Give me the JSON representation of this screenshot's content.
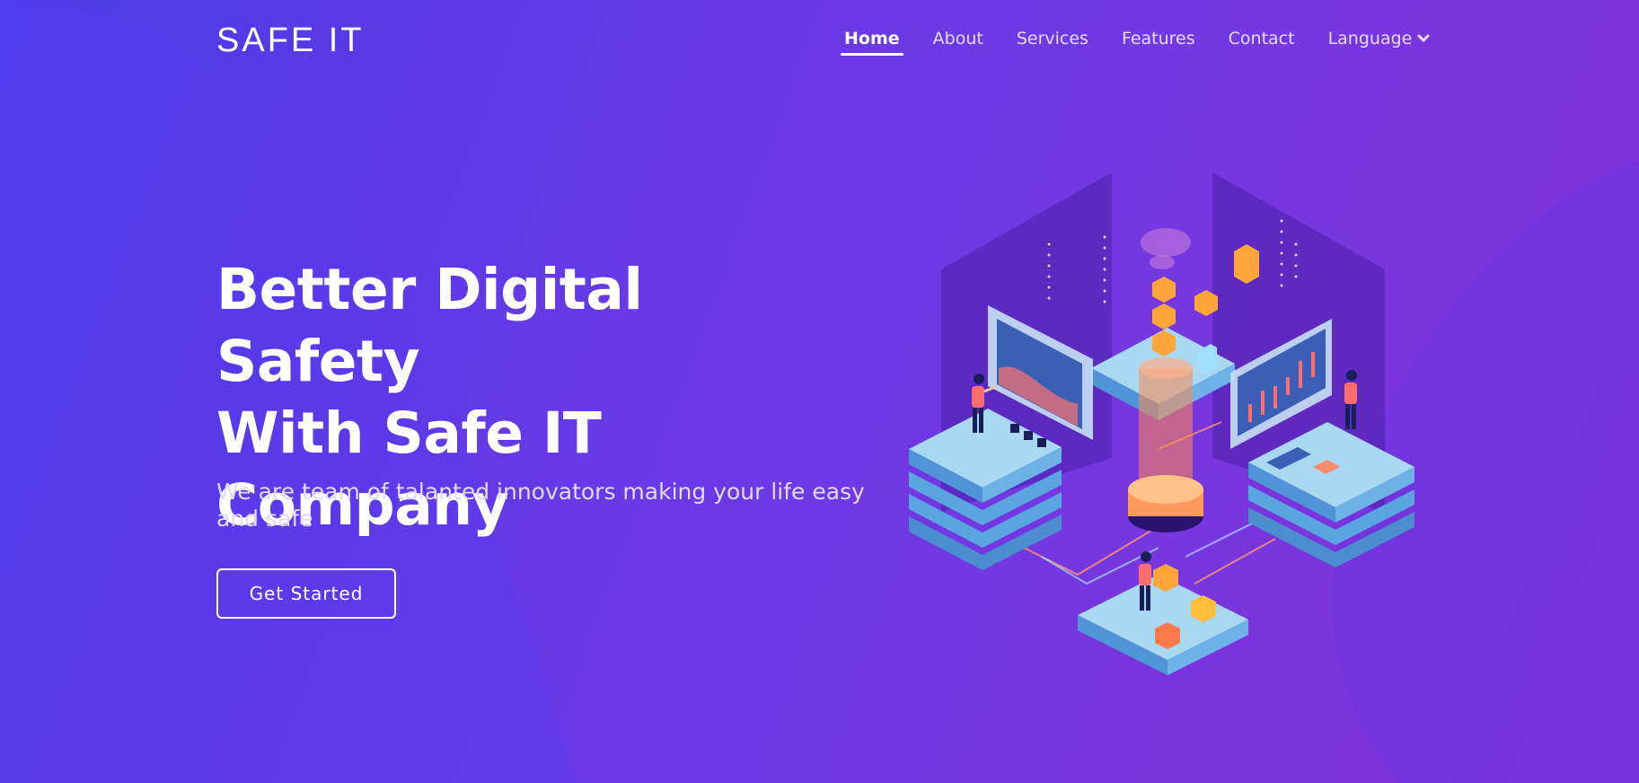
{
  "header": {
    "logo": "SAFE IT",
    "nav": [
      {
        "label": "Home",
        "active": true
      },
      {
        "label": "About"
      },
      {
        "label": "Services"
      },
      {
        "label": "Features"
      },
      {
        "label": "Contact"
      },
      {
        "label": "Language",
        "icon": "chevron-down-icon"
      }
    ]
  },
  "hero": {
    "title_lines": [
      "Better Digital Safety",
      "With Safe IT",
      "Company"
    ],
    "subtitle": "We are team of talanted innovators making your life easy and safe",
    "cta_label": "Get Started",
    "illustration": "isometric-server-platforms-illustration"
  },
  "colors": {
    "bg_start": "#4d3ae8",
    "bg_end": "#7c33d6",
    "accent_orange": "#ff8a4c",
    "platform_blue": "#9fd0f0"
  }
}
